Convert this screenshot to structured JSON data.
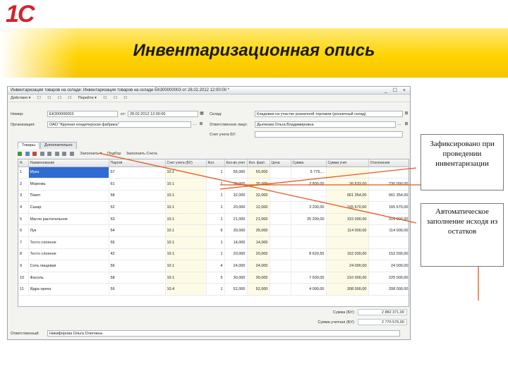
{
  "logo": {
    "text": "1С"
  },
  "slide_title": "Инвентаризационная опись",
  "window": {
    "title": "Инвентаризация товаров на складе: Инвентаризация товаров на складе ЕК300000003 от 28.02.2012 12:00:00 *",
    "controls": "_ ☐ ×",
    "menu": [
      "Действия ▾",
      "☐",
      "☐",
      "☐",
      "☐",
      "Перейти ▾",
      "☐",
      "☐",
      "☐"
    ],
    "header": {
      "number_label": "Номер:",
      "number_value": "ЕК300000003",
      "date_label": "от:",
      "date_value": "28.02.2012 12:00:00",
      "org_label": "Организация:",
      "org_value": "ОАО \"Крупная кондитерская фабрика\"",
      "warehouse_label": "Склад:",
      "warehouse_value": "Кладовая на участке розничной торговли (розничный склад)",
      "responsible_label": "Ответственное лицо:",
      "responsible_value": "Дьячкова Ольга Владимировна",
      "account_label": "Счет учета БУ:",
      "account_value": ""
    },
    "tabs": [
      "Товары",
      "Дополнительно"
    ],
    "toolbar": {
      "fill": "Заполнить ▾",
      "select": "Подбор",
      "fill_accounts": "Заполнить Счета"
    },
    "columns": [
      "N",
      "Наименование",
      "Партия",
      "Счет учета (БУ)",
      "Кол.",
      "Кол-во учет",
      "Кол. факт.",
      "Цена",
      "Сумма",
      "Сумма учет",
      "Отклонение"
    ],
    "rows": [
      {
        "n": "1",
        "name": "Мука",
        "party": "57",
        "account": "10.1",
        "k": "1",
        "qty_acc": "56,000",
        "qty_fact": "55,000",
        "price": "",
        "sum": "5 775,...",
        "sum_acc": "",
        "dev": ""
      },
      {
        "n": "2",
        "name": "Морковь",
        "party": "61",
        "account": "10.1",
        "k": "1",
        "qty_acc": "30,000",
        "qty_fact": "35,000",
        "price": "",
        "sum": "3 800,00",
        "sum_acc": "26 633,00",
        "dev": "230 000,00"
      },
      {
        "n": "3",
        "name": "Пакет",
        "party": "58",
        "account": "10.1",
        "k": "1",
        "qty_acc": "32,000",
        "qty_fact": "32,000",
        "price": "",
        "sum": "",
        "sum_acc": "661 354,00",
        "dev": "661 354,00"
      },
      {
        "n": "4",
        "name": "Сахар",
        "party": "52",
        "account": "10.1",
        "k": "1",
        "qty_acc": "20,000",
        "qty_fact": "12,000",
        "price": "",
        "sum": "3 200,00",
        "sum_acc": "165 670,00",
        "dev": "165 670,00"
      },
      {
        "n": "5",
        "name": "Масло растительное",
        "party": "53",
        "account": "10.1",
        "k": "1",
        "qty_acc": "21,000",
        "qty_fact": "21,000",
        "price": "",
        "sum": "25 200,00",
        "sum_acc": "315 000,00",
        "dev": "315 000,00"
      },
      {
        "n": "6",
        "name": "Лук",
        "party": "54",
        "account": "10.1",
        "k": "6",
        "qty_acc": "30,000",
        "qty_fact": "35,000",
        "price": "",
        "sum": "",
        "sum_acc": "114 000,00",
        "dev": "114 000,00"
      },
      {
        "n": "7",
        "name": "Тесто слоеное",
        "party": "55",
        "account": "10.1",
        "k": "1",
        "qty_acc": "14,000",
        "qty_fact": "14,000",
        "price": "",
        "sum": "",
        "sum_acc": "",
        "dev": ""
      },
      {
        "n": "8",
        "name": "Тесто слоеное",
        "party": "42",
        "account": "10.1",
        "k": "1",
        "qty_acc": "20,000",
        "qty_fact": "20,000",
        "price": "",
        "sum": "8 620,55",
        "sum_acc": "152 030,00",
        "dev": "152 030,00"
      },
      {
        "n": "9",
        "name": "Соль пищевая",
        "party": "56",
        "account": "10.1",
        "k": "4",
        "qty_acc": "24,000",
        "qty_fact": "24,000",
        "price": "",
        "sum": "",
        "sum_acc": "24 000,00",
        "dev": "24 000,00"
      },
      {
        "n": "10",
        "name": "Фасоль",
        "party": "58",
        "account": "10.1",
        "k": "5",
        "qty_acc": "30,000",
        "qty_fact": "30,000",
        "price": "",
        "sum": "7 500,00",
        "sum_acc": "210 000,00",
        "dev": "225 000,00"
      },
      {
        "n": "11",
        "name": "Ядра ореха",
        "party": "59",
        "account": "10.4",
        "k": "1",
        "qty_acc": "52,000",
        "qty_fact": "52,000",
        "price": "",
        "sum": "4 000,00",
        "sum_acc": "208 000,00",
        "dev": "208 000,00"
      }
    ],
    "totals": {
      "sum_label": "Сумма (БУ):",
      "sum_value": "2 882 371,00",
      "sum_acc_label": "Сумма учетная (БУ):",
      "sum_acc_value": "2 770 576,00"
    },
    "comment_label": "Ответственный:",
    "comment_value": "Никифорова Ольга Олеговна"
  },
  "callouts": {
    "fixed": "Зафиксировано при проведении инвентаризации",
    "auto": "Автоматическое заполнение исходя из остатков"
  }
}
